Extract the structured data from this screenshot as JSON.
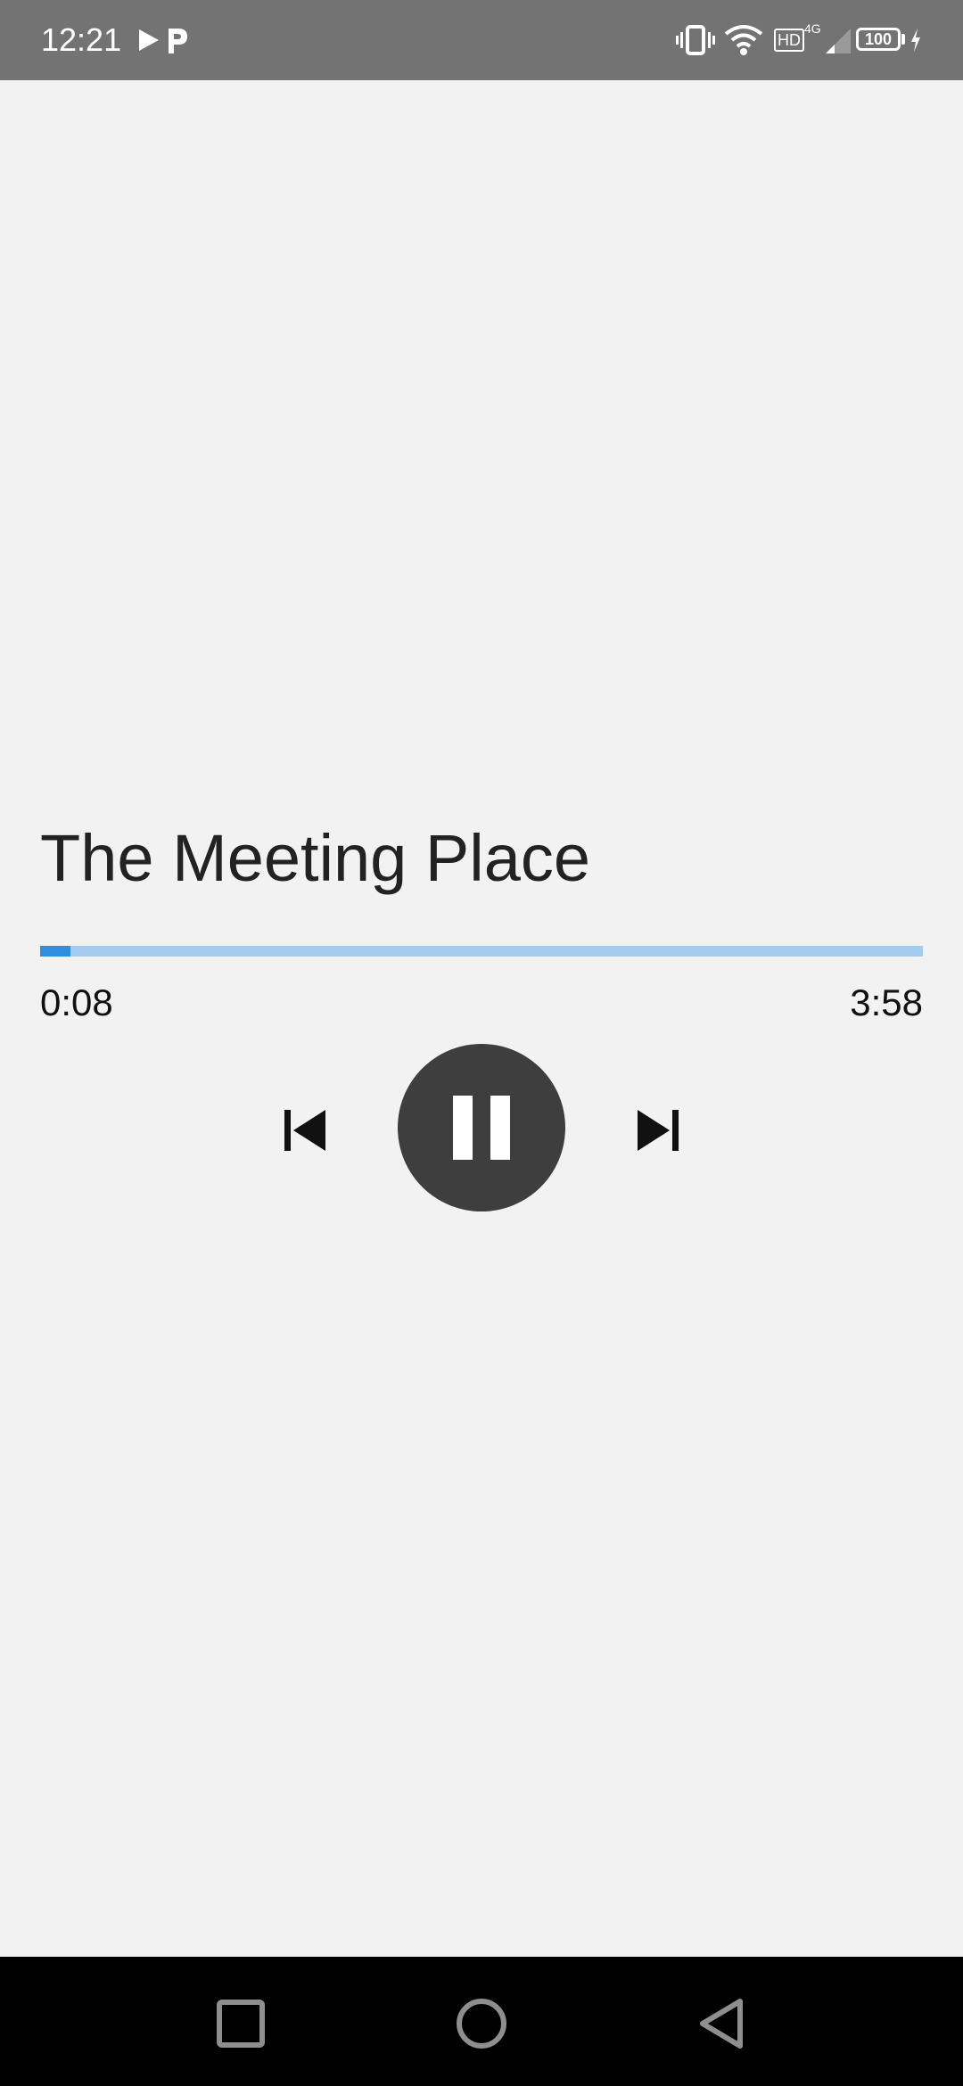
{
  "status_bar": {
    "time": "12:21",
    "battery": "100",
    "network_label": "HD",
    "network_type": "4G",
    "left_icons": [
      "play-icon",
      "p-app-icon"
    ],
    "right_icons": [
      "vibrate-icon",
      "wifi-icon",
      "hd-icon",
      "signal-icon",
      "battery-icon",
      "charging-icon"
    ]
  },
  "player": {
    "title": "The Meeting Place",
    "elapsed": "0:08",
    "duration": "3:58",
    "progress_fraction": 0.034,
    "is_playing": true,
    "controls": {
      "previous": "skip-previous-icon",
      "play_pause": "pause-icon",
      "next": "skip-next-icon"
    },
    "colors": {
      "background": "#f2f2f2",
      "progress_track": "#a3ccee",
      "progress_fill": "#2e8ee0",
      "play_button": "#3e3e3e"
    }
  },
  "nav_bar": {
    "buttons": [
      "recents-icon",
      "home-icon",
      "back-icon"
    ]
  }
}
